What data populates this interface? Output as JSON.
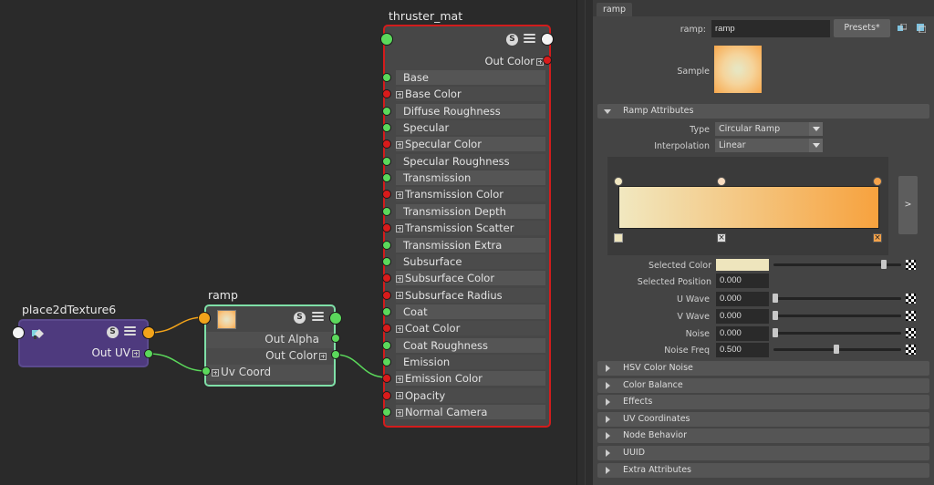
{
  "graph": {
    "place2d": {
      "title": "place2dTexture6",
      "out_uv": "Out UV"
    },
    "ramp_node": {
      "title": "ramp",
      "out_alpha": "Out Alpha",
      "out_color": "Out Color",
      "uv_coord": "Uv Coord"
    },
    "material": {
      "title": "thruster_mat",
      "out_color": "Out Color",
      "attributes": [
        "Base",
        "Base Color",
        "Diffuse Roughness",
        "Specular",
        "Specular Color",
        "Specular Roughness",
        "Transmission",
        "Transmission Color",
        "Transmission Depth",
        "Transmission Scatter",
        "Transmission Extra Roughness",
        "Subsurface",
        "Subsurface Color",
        "Subsurface Radius",
        "Coat",
        "Coat Color",
        "Coat Roughness",
        "Emission",
        "Emission Color",
        "Opacity",
        "Normal Camera"
      ]
    },
    "shader_switch_glyph": "S"
  },
  "attribute_editor": {
    "tab": "ramp",
    "name_label": "ramp:",
    "name_value": "ramp",
    "presets_label": "Presets*",
    "sample_label": "Sample",
    "ramp_section": "Ramp Attributes",
    "type_label": "Type",
    "type_value": "Circular Ramp",
    "interp_label": "Interpolation",
    "interp_value": "Linear",
    "expand_glyph": ">",
    "selected_color_label": "Selected Color",
    "selected_position_label": "Selected Position",
    "selected_position_value": "0.000",
    "u_wave_label": "U Wave",
    "u_wave_value": "0.000",
    "v_wave_label": "V Wave",
    "v_wave_value": "0.000",
    "noise_label": "Noise",
    "noise_value": "0.000",
    "noise_freq_label": "Noise Freq",
    "noise_freq_value": "0.500",
    "sections": [
      "HSV Color Noise",
      "Color Balance",
      "Effects",
      "UV Coordinates",
      "Node Behavior",
      "UUID",
      "Extra Attributes"
    ]
  },
  "colors": {
    "ramp_start": "#f1e8c0",
    "ramp_end": "#f7a23e",
    "selected_color": "#eee5bd",
    "material_border": "#d21c1c",
    "ramp_border": "#7fe0a8",
    "place2d_fill": "#4e3a7e"
  }
}
